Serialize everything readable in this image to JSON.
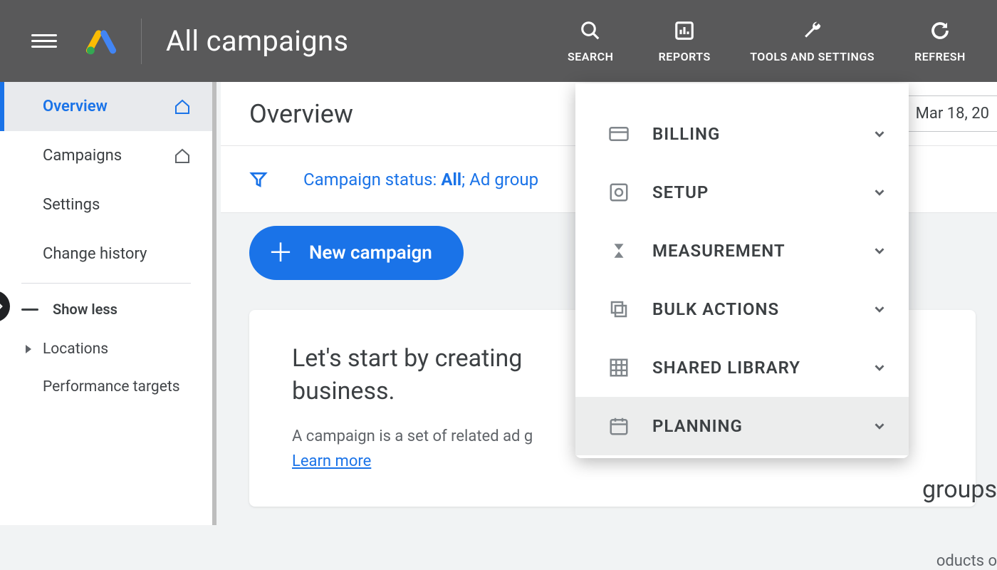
{
  "header": {
    "title": "All campaigns",
    "nav": {
      "search": "SEARCH",
      "reports": "REPORTS",
      "tools": "TOOLS AND SETTINGS",
      "refresh": "REFRESH"
    }
  },
  "sidebar": {
    "overview": "Overview",
    "campaigns": "Campaigns",
    "settings": "Settings",
    "history": "Change history",
    "showless": "Show less",
    "locations": "Locations",
    "perf": "Performance targets"
  },
  "main": {
    "page_title": "Overview",
    "date_range": "Mar 18, 20",
    "filter_label": "Campaign status: ",
    "filter_bold": "All",
    "filter_tail": "; Ad group",
    "new_campaign": "New campaign",
    "card_heading_left": "Let's start by creating",
    "card_heading_right": "groups",
    "card_heading_suffix": " business.",
    "card_sub": "A campaign is a set of related ad g",
    "card_sub_right": "oducts o",
    "learn_more": "Learn more"
  },
  "dropdown": {
    "items": [
      {
        "label": "BILLING",
        "icon": "card"
      },
      {
        "label": "SETUP",
        "icon": "gear"
      },
      {
        "label": "MEASUREMENT",
        "icon": "hourglass"
      },
      {
        "label": "BULK ACTIONS",
        "icon": "stack"
      },
      {
        "label": "SHARED LIBRARY",
        "icon": "grid"
      },
      {
        "label": "PLANNING",
        "icon": "calendar",
        "hover": true
      }
    ]
  }
}
